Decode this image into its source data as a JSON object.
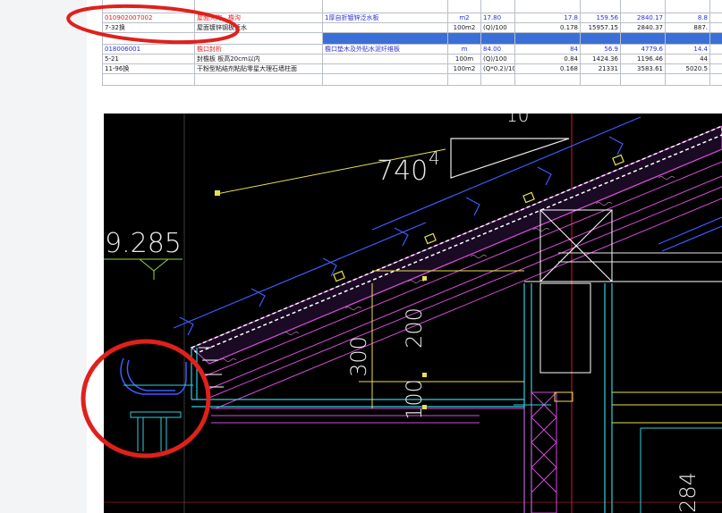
{
  "estimate_table": {
    "rows": [
      {
        "kind": "item",
        "code": "010902007002",
        "name": "屋面天沟、檐沟",
        "feature": "1厚自折镀锌泛水板",
        "unit": "m2",
        "qty": "17.80",
        "v1": "17.8",
        "v2": "159.56",
        "v3": "2840.17",
        "v4": "8.8"
      },
      {
        "kind": "sub",
        "code": "7-32换",
        "name": "屋面镀锌钢板泛水",
        "feature": "",
        "unit": "100m2",
        "qty": "(Q)/100",
        "v1": "0.178",
        "v2": "15957.15",
        "v3": "2840.37",
        "v4": "887."
      },
      {
        "kind": "item",
        "code": "018006001",
        "name": "檐口封析",
        "feature": "檐口垫木及外贴水泥纤维板",
        "unit": "m",
        "qty": "84.00",
        "v1": "84",
        "v2": "56.9",
        "v3": "4779.6",
        "v4": "14.4"
      },
      {
        "kind": "sub",
        "code": "5-21",
        "name": "封檐板 板高20cm以内",
        "feature": "",
        "unit": "100m",
        "qty": "(Q)/100",
        "v1": "0.84",
        "v2": "1424.36",
        "v3": "1196.46",
        "v4": "44"
      },
      {
        "kind": "sub",
        "code": "11-96换",
        "name": "干粉型粘结剂粘贴零星大理石墙柱面",
        "feature": "",
        "unit": "100m2",
        "qty": "(Q*0.2)/100",
        "v1": "0.168",
        "v2": "21331",
        "v3": "3583.61",
        "v4": "5020.5"
      }
    ]
  },
  "drawing": {
    "dim_top": "10",
    "dim_740": "740",
    "dim_4": "4",
    "level_label": "9.285",
    "dim_300": "300",
    "dim_200": "200",
    "dim_100": "100",
    "dim_284": "284"
  },
  "colors": {
    "annotation": "#e0201c",
    "blue_band": "#3b6fd8",
    "cad_background": "#000000"
  }
}
